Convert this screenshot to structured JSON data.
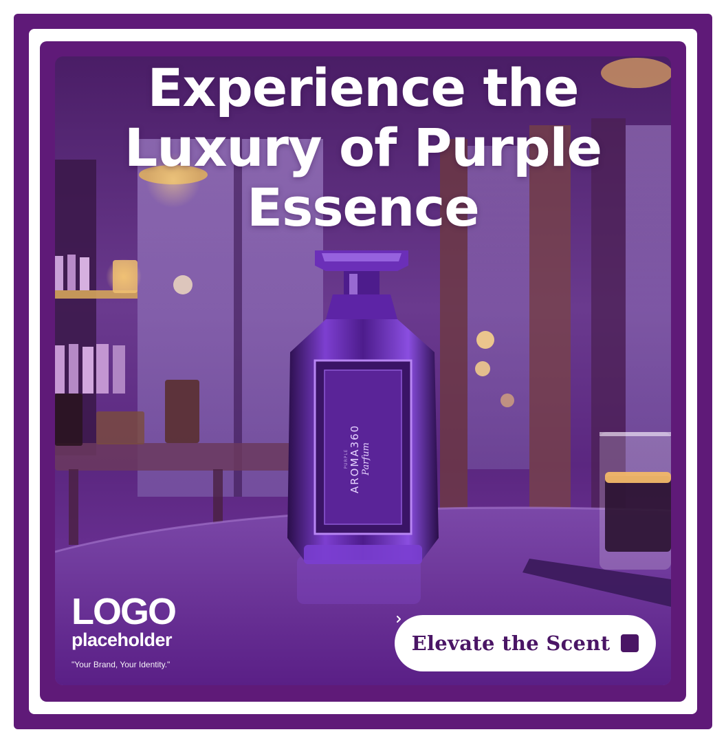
{
  "ad": {
    "headline": [
      "Experience the",
      "Luxury of Purple",
      "Essence"
    ],
    "bottle_label": {
      "brand": "AROMA360",
      "sub": "Parfum",
      "tiny": "PURPLE"
    },
    "logo": {
      "main": "LOGO",
      "sub": "placeholder",
      "tagline": "\"Your Brand, Your Identity.\""
    },
    "cta": {
      "label": "Elevate the Scent",
      "icon": "chevron-right-icon"
    }
  },
  "colors": {
    "frame_purple": "#5f1a78",
    "white": "#ffffff",
    "cta_text": "#4a1565",
    "bottle_purple": "#6b2fb8"
  }
}
